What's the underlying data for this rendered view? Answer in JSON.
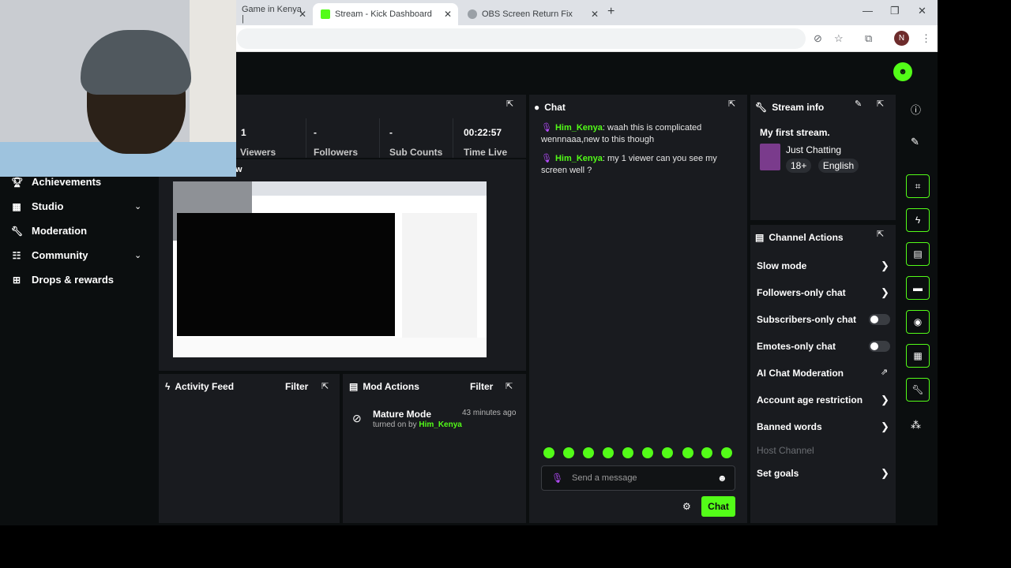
{
  "browser": {
    "tabs": [
      {
        "label": "Game in Kenya |"
      },
      {
        "label": "Stream - Kick Dashboard"
      },
      {
        "label": "OBS Screen Return Fix"
      }
    ],
    "profile_initial": "N"
  },
  "sidebar": {
    "items": [
      {
        "label": "Achievements",
        "icon": "trophy-icon"
      },
      {
        "label": "Studio",
        "icon": "film-icon"
      },
      {
        "label": "Moderation",
        "icon": "wrench-icon"
      },
      {
        "label": "Community",
        "icon": "community-icon"
      },
      {
        "label": "Drops & rewards",
        "icon": "gift-icon"
      }
    ]
  },
  "stats": {
    "items": [
      {
        "value": "1",
        "label": "Viewers"
      },
      {
        "value": "-",
        "label": "Followers"
      },
      {
        "value": "-",
        "label": "Sub Counts"
      },
      {
        "value": "00:22:57",
        "label": "Time Live"
      }
    ],
    "preview_partial_label": "w"
  },
  "chat": {
    "title": "Chat",
    "messages": [
      {
        "user": "Him_Kenya",
        "text": " waah this is complicated wennnaaa,new to this though"
      },
      {
        "user": "Him_Kenya",
        "text": " my 1 viewer can you see my screen well ?"
      }
    ],
    "input_placeholder": "Send a message",
    "send_label": "Chat"
  },
  "stream_info": {
    "title": "Stream info",
    "stream_title": "My first stream.",
    "category": "Just Chatting",
    "tags": [
      "18+",
      "English"
    ]
  },
  "channel_actions": {
    "title": "Channel Actions",
    "items": [
      {
        "label": "Slow mode"
      },
      {
        "label": "Followers-only chat"
      },
      {
        "label": "Subscribers-only chat"
      },
      {
        "label": "Emotes-only chat"
      },
      {
        "label": "AI Chat Moderation"
      },
      {
        "label": "Account age restriction"
      },
      {
        "label": "Banned words"
      },
      {
        "label": "Host Channel"
      },
      {
        "label": "Set goals"
      }
    ]
  },
  "activity_feed": {
    "title": "Activity Feed",
    "filter_label": "Filter"
  },
  "mod_actions": {
    "title": "Mod Actions",
    "filter_label": "Filter",
    "entry": {
      "title": "Mature Mode",
      "time": "43 minutes ago",
      "prefix": "turned on by ",
      "user": "Him_Kenya"
    }
  },
  "colors": {
    "accent": "#53fc18",
    "panel": "#191b1f",
    "background": "#0b0e0f",
    "mic": "#b64cff"
  }
}
